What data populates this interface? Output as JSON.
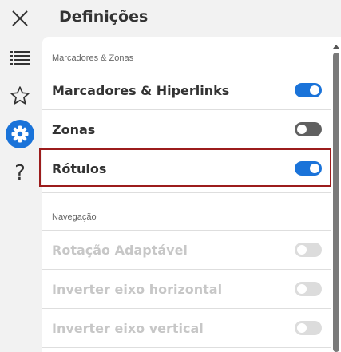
{
  "sidebar": {
    "items": [
      {
        "icon": "close-icon",
        "name": "close"
      },
      {
        "icon": "list-icon",
        "name": "contents"
      },
      {
        "icon": "star-icon",
        "name": "bookmarks"
      },
      {
        "icon": "gear-icon",
        "name": "settings",
        "active": true
      },
      {
        "icon": "help-icon",
        "name": "help",
        "glyph": "?"
      }
    ]
  },
  "header": {
    "title": "Definições"
  },
  "sections": [
    {
      "label": "Marcadores & Zonas",
      "settings": [
        {
          "label": "Marcadores & Hiperlinks",
          "enabled": true,
          "on": true
        },
        {
          "label": "Zonas",
          "enabled": true,
          "on": false
        },
        {
          "label": "Rótulos",
          "enabled": true,
          "on": true,
          "highlighted": true
        }
      ]
    },
    {
      "label": "Navegação",
      "settings": [
        {
          "label": "Rotação Adaptável",
          "enabled": false,
          "on": false
        },
        {
          "label": "Inverter eixo horizontal",
          "enabled": false,
          "on": false
        },
        {
          "label": "Inverter eixo vertical",
          "enabled": false,
          "on": false
        }
      ]
    }
  ],
  "colors": {
    "accent": "#1a73d9",
    "highlight_border": "#9c1c1c",
    "toggle_off": "#606060",
    "toggle_disabled": "#dcdcdc"
  }
}
